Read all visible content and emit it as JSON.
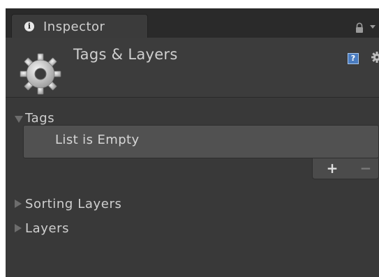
{
  "window": {
    "tab_label": "Inspector",
    "info_icon": "info-icon",
    "lock_icon": "lock-icon",
    "menu_icon": "dropdown-icon"
  },
  "header": {
    "title": "Tags & Layers",
    "asset_icon": "gear-icon",
    "help_icon": "help-icon",
    "settings_icon": "gear-icon"
  },
  "sections": {
    "tags": {
      "label": "Tags",
      "expanded": true,
      "empty_text": "List is Empty",
      "add_symbol": "+",
      "remove_symbol": "−"
    },
    "sorting_layers": {
      "label": "Sorting Layers",
      "expanded": false
    },
    "layers": {
      "label": "Layers",
      "expanded": false
    }
  },
  "colors": {
    "panel_background": "#393939",
    "header_background": "#3c3c3c",
    "text": "#cfcfcf",
    "list_background": "#515151",
    "help_icon": "#4a7cc0"
  }
}
